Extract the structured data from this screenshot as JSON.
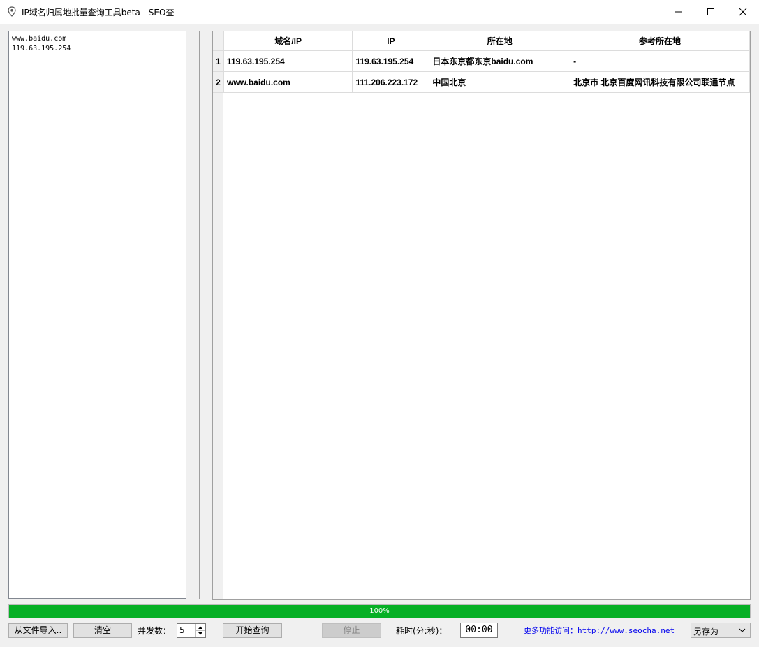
{
  "window": {
    "title": "IP域名归属地批量查询工具beta - SEO查"
  },
  "input": {
    "text": "www.baidu.com\n119.63.195.254"
  },
  "table": {
    "headers": [
      "域名/IP",
      "IP",
      "所在地",
      "参考所在地"
    ],
    "rows": [
      {
        "num": "1",
        "domain": "119.63.195.254",
        "ip": "119.63.195.254",
        "location": "日本东京都东京baidu.com",
        "ref_location": "-"
      },
      {
        "num": "2",
        "domain": "www.baidu.com",
        "ip": "111.206.223.172",
        "location": "中国北京",
        "ref_location": "北京市 北京百度网讯科技有限公司联通节点"
      }
    ]
  },
  "progress": {
    "value": 100,
    "text": "100%",
    "color": "#06b025"
  },
  "toolbar": {
    "import_label": "从文件导入..",
    "clear_label": "清空",
    "concurrency_label": "并发数：",
    "concurrency_value": "5",
    "start_label": "开始查询",
    "stop_label": "停止",
    "elapsed_label": "耗时(分:秒)：",
    "elapsed_value": "00:00",
    "more_link": "更多功能访问：http://www.seocha.net",
    "save_as_label": "另存为"
  }
}
